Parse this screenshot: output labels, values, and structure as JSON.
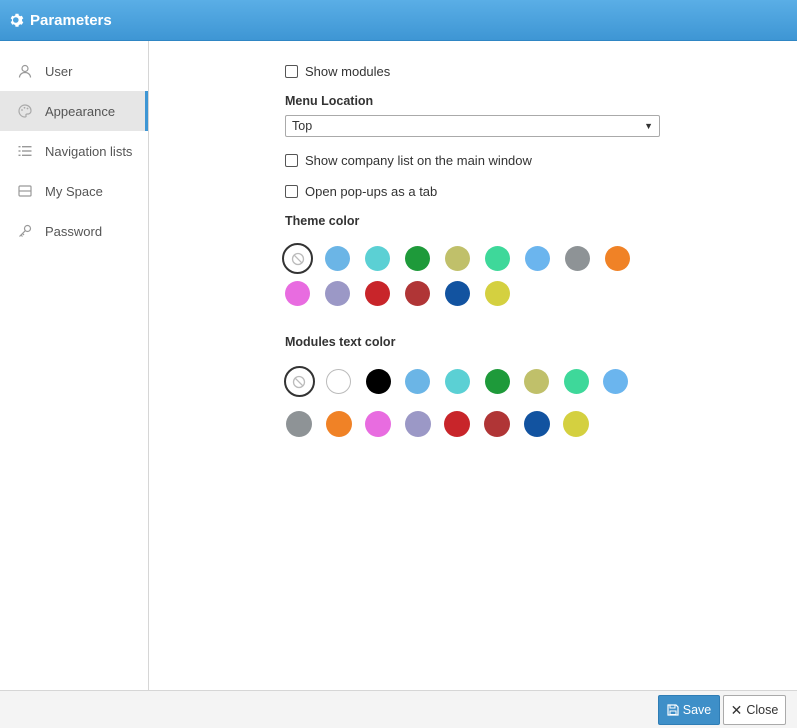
{
  "window": {
    "title": "Parameters",
    "icon": "gear-icon"
  },
  "sidebar": {
    "items": [
      {
        "label": "User",
        "icon": "user-icon",
        "active": false
      },
      {
        "label": "Appearance",
        "icon": "palette-icon",
        "active": true
      },
      {
        "label": "Navigation lists",
        "icon": "list-icon",
        "active": false
      },
      {
        "label": "My Space",
        "icon": "box-icon",
        "active": false
      },
      {
        "label": "Password",
        "icon": "key-icon",
        "active": false
      }
    ]
  },
  "appearance": {
    "show_modules": {
      "label": "Show modules",
      "checked": false
    },
    "menu_location": {
      "label": "Menu Location",
      "value": "Top"
    },
    "show_company_list": {
      "label": "Show company list on the main window",
      "checked": false
    },
    "open_popups": {
      "label": "Open pop-ups as a tab",
      "checked": false
    },
    "theme_color": {
      "label": "Theme color",
      "selected": "none",
      "swatches": [
        "none",
        "#6bb5e6",
        "#5bd0d4",
        "#1e9a3a",
        "#c0c06a",
        "#3ed89a",
        "#6bb5ee",
        "#8e9396",
        "#f08226",
        "#e86ce0",
        "#9b98c6",
        "#c8252a",
        "#b03536",
        "#1253a0",
        "#d4d040"
      ]
    },
    "modules_text_color": {
      "label": "Modules text color",
      "selected": "none",
      "swatches": [
        "none",
        "#ffffff",
        "#000000",
        "#6bb5e6",
        "#5bd0d4",
        "#1e9a3a",
        "#c0c06a",
        "#3ed89a",
        "#6bb5ee",
        "#8e9396",
        "#f08226",
        "#e86ce0",
        "#9b98c6",
        "#c8252a",
        "#b03536",
        "#1253a0",
        "#d4d040"
      ]
    }
  },
  "footer": {
    "save_label": "Save",
    "close_label": "Close"
  }
}
